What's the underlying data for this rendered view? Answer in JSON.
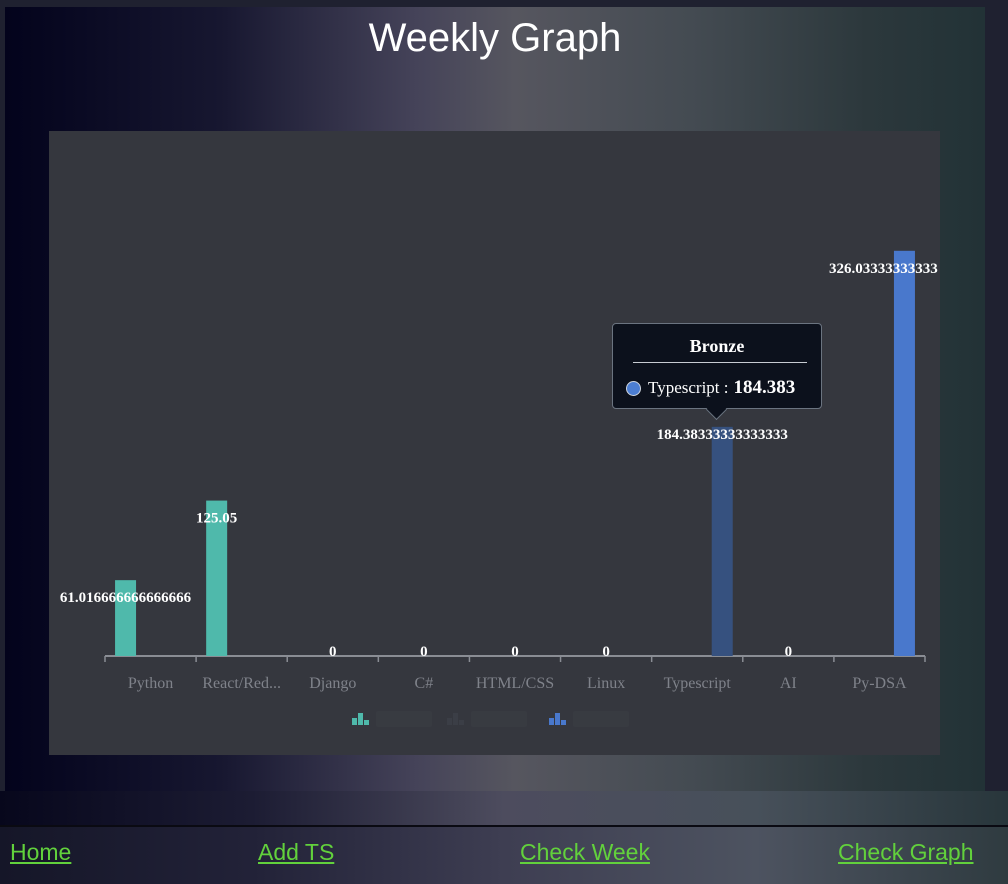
{
  "page": {
    "title": "Weekly Graph"
  },
  "nav": {
    "home": "Home",
    "add_ts": "Add TS",
    "check_week": "Check Week",
    "check_graph": "Check Graph"
  },
  "colors": {
    "teal": "#4fb9ab",
    "dark": "#3b3e46",
    "blue": "#4978cc",
    "highlight": "#36517f",
    "link": "#62d13c"
  },
  "chart_data": {
    "type": "bar",
    "categories": [
      "Python",
      "React/Red...",
      "Django",
      "C#",
      "HTML/CSS",
      "Linux",
      "Typescript",
      "AI",
      "Py-DSA"
    ],
    "series": [
      {
        "color": "#4fb9ab",
        "values": [
          61.016666666666666,
          125.05,
          0,
          0,
          0,
          0,
          0,
          0,
          0
        ]
      },
      {
        "color": "#3b3e46",
        "values": [
          0,
          0,
          0,
          0,
          0,
          0,
          0,
          0,
          0
        ]
      },
      {
        "color": "#4978cc",
        "values": [
          0,
          0,
          0,
          0,
          0,
          0,
          184.38333333333333,
          0,
          326.03333333333
        ]
      }
    ],
    "data_labels": [
      {
        "category": "Python",
        "text": "61.016666666666666"
      },
      {
        "category": "React/Red...",
        "text": "125.05"
      },
      {
        "category": "Django",
        "text": "0"
      },
      {
        "category": "C#",
        "text": "0"
      },
      {
        "category": "HTML/CSS",
        "text": "0"
      },
      {
        "category": "Linux",
        "text": "0"
      },
      {
        "category": "Typescript",
        "text": "184.38333333333333"
      },
      {
        "category": "AI",
        "text": "0"
      },
      {
        "category": "Py-DSA",
        "text": "326.03333333333"
      }
    ],
    "highlighted_category": "Typescript",
    "ylim": [
      0,
      350
    ],
    "legend": {
      "position": "bottom-center"
    }
  },
  "tooltip": {
    "title": "Bronze",
    "label": "Typescript :",
    "value": "184.383"
  }
}
